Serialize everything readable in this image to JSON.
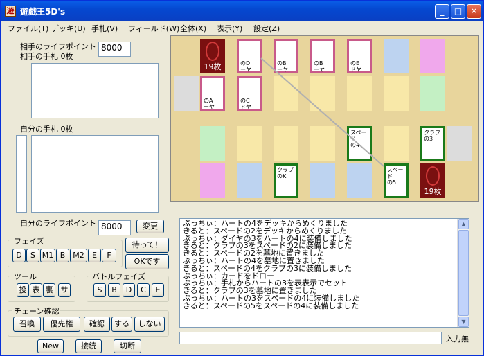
{
  "window": {
    "title": "遊戯王5D's",
    "app_icon": "遊",
    "controls": {
      "minimize": "_",
      "maximize": "□",
      "close": "✕"
    }
  },
  "menu": [
    "ファイル(T)",
    "デッキ(U)",
    "手札(V)",
    "フィールド(W)",
    "全体(X)",
    "表示(Y)",
    "設定(Z)"
  ],
  "opponent": {
    "life_label": "相手のライフポイント",
    "life_value": "8000",
    "hand_label": "相手の手札  0枚"
  },
  "self": {
    "hand_label": "自分の手札  0枚",
    "life_label": "自分のライフポイント",
    "life_value": "8000",
    "change_button": "変更"
  },
  "phase": {
    "label": "フェイズ",
    "buttons": [
      "D",
      "S",
      "M1",
      "B",
      "M2",
      "E",
      "F"
    ]
  },
  "wait_button": "待って！",
  "ok_button": "OKです",
  "tools": {
    "label": "ツール",
    "buttons": [
      "投",
      "表",
      "裏",
      "サ"
    ]
  },
  "battle": {
    "label": "バトルフェイズ",
    "buttons": [
      "S",
      "B",
      "D",
      "C",
      "E"
    ]
  },
  "chain": {
    "label": "チェーン確認",
    "buttons": [
      "召喚",
      "優先権",
      "確認",
      "する",
      "しない"
    ]
  },
  "bottom_buttons": [
    "New",
    "接続",
    "切断"
  ],
  "field": {
    "opponent_deck_count": "19枚",
    "self_deck_count": "19枚",
    "opp_cards_row1": [
      {
        "line1": "のD",
        "line2": "ーヤ"
      },
      {
        "line1": "のB",
        "line2": "ーヤ"
      },
      {
        "line1": "のB",
        "line2": "ーヤ"
      },
      {
        "line1": "のE",
        "line2": "ドヤ"
      }
    ],
    "opp_cards_row2": [
      {
        "line1": "のA",
        "line2": "ーヤ"
      },
      {
        "line1": "のC",
        "line2": "ドヤ"
      }
    ],
    "self_spade4": {
      "line1": "スペード",
      "line2": "の4"
    },
    "self_club3": {
      "line1": "クラブ",
      "line2": "の3"
    },
    "self_clubK": {
      "line1": "クラブ",
      "line2": "のK"
    },
    "self_spade5": {
      "line1": "スペード",
      "line2": "の5"
    }
  },
  "log": [
    "ぷっちぃ：ハートの4をデッキからめくりました",
    "きると：スペードの2をデッキからめくりました",
    "ぷっちぃ：ダイヤの3をハートの4に装備しました",
    "きると：クラブの3をスペードの2に装備しました",
    "きると：スペードの2を墓地に置きました",
    "ぷっちぃ：ハートの4を墓地に置きました",
    "きると：スペードの4をクラブの3に装備しました",
    "ぷっちぃ：カードをドロー",
    "ぷっちぃ：手札からハートの3を表表示でセット",
    "きると：クラブの3を墓地に置きました",
    "ぷっちぃ：ハートの3をスペードの4に装備しました",
    "きると：スペードの5をスペードの4に装備しました"
  ],
  "input": {
    "value": "",
    "mode_label": "入力無"
  },
  "colors": {
    "field": "#e8d59c",
    "pink_border": "#c85a8a",
    "green_border": "#1a7a1a",
    "deck": "#7a1010",
    "zone_blue": "#bdd3f0",
    "zone_pink": "#f0a8ec",
    "zone_green": "#c4f0c4",
    "zone_gray": "#dcdcdc",
    "zone_cream": "#f8e8a8"
  }
}
